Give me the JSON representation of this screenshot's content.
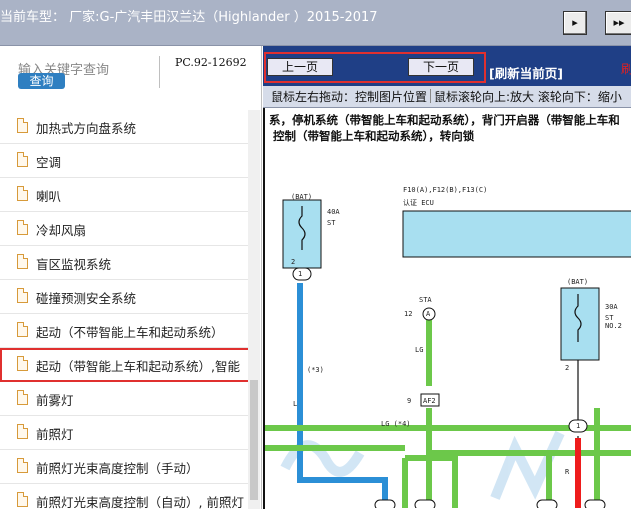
{
  "window": {
    "title": "当前车型：  厂家:G-广汽丰田汉兰达（Highlander ）2015-2017",
    "nav_right_1": "▸",
    "nav_right_2": "▸▸"
  },
  "sidebar": {
    "search_placeholder": "输入关键字查询",
    "search_button": "查询",
    "pc_label": "PC.92-12692",
    "items": [
      {
        "label": "加热式方向盘系统"
      },
      {
        "label": "空调"
      },
      {
        "label": "喇叭"
      },
      {
        "label": "冷却风扇"
      },
      {
        "label": "盲区监视系统"
      },
      {
        "label": "碰撞预测安全系统"
      },
      {
        "label": "起动（不带智能上车和起动系统）"
      },
      {
        "label": "起动（带智能上车和起动系统）,智能"
      },
      {
        "label": "前雾灯"
      },
      {
        "label": "前照灯"
      },
      {
        "label": "前照灯光束高度控制（手动）"
      },
      {
        "label": "前照灯光束高度控制（自动）, 前照灯"
      }
    ]
  },
  "viewer": {
    "prev_page": "上一页",
    "next_page": "下一页",
    "refresh": "[刷新当前页]",
    "refresh_red": "刷",
    "hint_drag": "鼠标左右拖动：控制图片位置",
    "hint_scroll": "鼠标滚轮向上:放大  滚轮向下：缩小",
    "system_line1": "系，停机系统（带智能上车和起动系统），背门开启器（带智能上车和",
    "system_line2": "控制（带智能上车和起动系统），转向锁",
    "diagram_labels": {
      "bat1": "(BAT)",
      "fuse1_a": "40A",
      "fuse1_b": "ST",
      "ecu_pins": "F10(A),F12(B),F13(C)",
      "ecu_name": "认证 ECU",
      "sta": "STA",
      "pin12": "12",
      "pinA": "A",
      "pin2a": "2",
      "pin1a": "1",
      "bat2": "(BAT)",
      "fuse2_a": "30A",
      "fuse2_b": "ST NO.2",
      "pin2b": "2",
      "pin1b": "1",
      "lg": "LG",
      "l": "L",
      "star3": "(*3)",
      "star4": "LG (*4)",
      "af2": "AF2",
      "pin9": "9",
      "r": "R"
    }
  },
  "colors": {
    "toolbar_bg": "#1f3f86",
    "highlight": "#e0302f",
    "green_wire": "#6cc84a",
    "blue_wire": "#2b8fd6",
    "red_wire": "#ee1c1c",
    "component_fill": "#a8dff0"
  }
}
